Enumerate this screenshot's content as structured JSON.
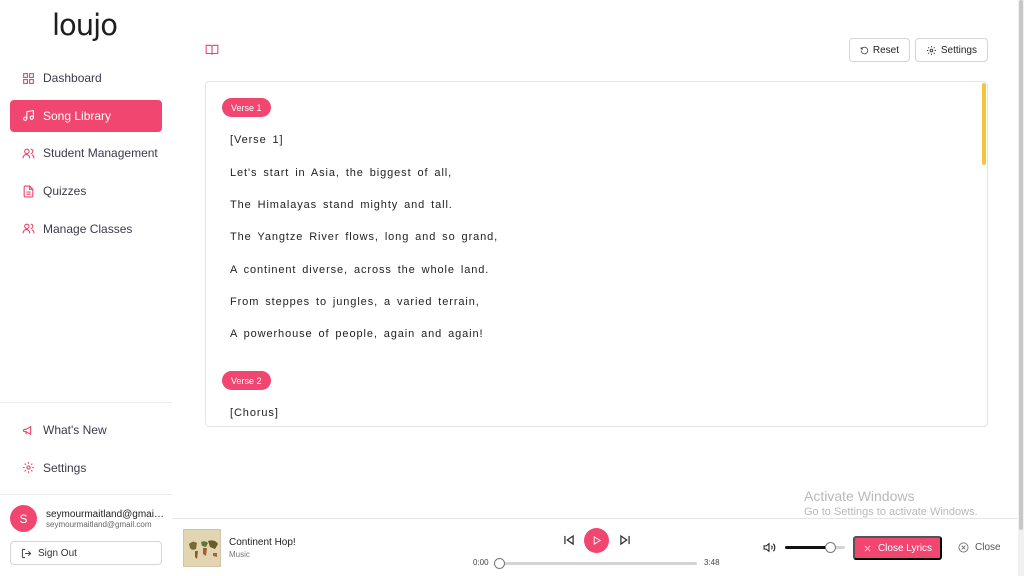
{
  "brand": {
    "logo": "loujo",
    "accent": "#f0466f",
    "scroll_accent": "#f5c43d"
  },
  "sidebar": {
    "items": [
      {
        "label": "Dashboard",
        "icon": "grid-icon",
        "active": false
      },
      {
        "label": "Song Library",
        "icon": "music-note-icon",
        "active": true
      },
      {
        "label": "Student Management",
        "icon": "users-icon",
        "active": false
      },
      {
        "label": "Quizzes",
        "icon": "document-icon",
        "active": false
      },
      {
        "label": "Manage Classes",
        "icon": "users-icon",
        "active": false
      }
    ],
    "bottom_items": [
      {
        "label": "What's New",
        "icon": "megaphone-icon"
      },
      {
        "label": "Settings",
        "icon": "gear-icon"
      }
    ],
    "user": {
      "initial": "S",
      "name": "seymourmaitland@gmail.com",
      "email": "seymourmaitland@gmail.com"
    },
    "sign_out": "Sign Out"
  },
  "toolbar": {
    "reset_label": "Reset",
    "settings_label": "Settings"
  },
  "lyrics": {
    "verse1_badge": "Verse 1",
    "verse2_badge": "Verse 2",
    "lines": [
      "[Verse 1]",
      "Let's start in Asia, the biggest of all,",
      "The Himalayas stand mighty and tall.",
      "The Yangtze River flows, long and so grand,",
      "A continent diverse, across the whole land.",
      "From steppes to jungles, a varied terrain,",
      "A powerhouse of people, again and again!"
    ],
    "chorus_line": "[Chorus]"
  },
  "watermark": {
    "title": "Activate Windows",
    "subtitle": "Go to Settings to activate Windows."
  },
  "player": {
    "song_title": "Continent Hop!",
    "song_subtitle": "Music",
    "current_time": "0:00",
    "duration": "3:48",
    "progress": 0,
    "volume": 0.75,
    "close_lyrics_label": "Close Lyrics",
    "close_label": "Close"
  }
}
